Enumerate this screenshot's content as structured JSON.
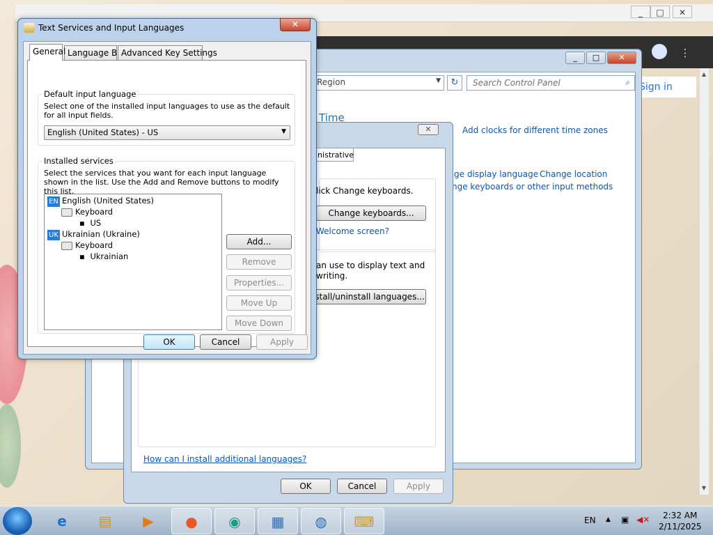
{
  "browser": {
    "title_buttons": [
      "_",
      "□",
      "✕"
    ],
    "sign_in": "Sign in"
  },
  "control_panel": {
    "window_buttons": [
      "_",
      "□",
      "✕"
    ],
    "address": "Region",
    "search_placeholder": "Search Control Panel",
    "heading": "Time",
    "links": {
      "add_clocks": "Add clocks for different time zones",
      "change_display_language": "ge display language",
      "change_location": "Change location",
      "change_keyboards_methods": "nge keyboards or other input methods"
    }
  },
  "region_dialog": {
    "close": "✕",
    "tab_partial": "inistrative",
    "keyboards_text": "lick Change keyboards.",
    "change_keyboards_button": "Change keyboards...",
    "welcome_link": "Welcome screen?",
    "display_text_line1": "an use to display text and",
    "display_text_line2": "writing.",
    "install_button": "stall/uninstall languages...",
    "install_link": "How can I install additional languages?",
    "ok": "OK",
    "cancel": "Cancel",
    "apply": "Apply"
  },
  "text_services": {
    "title": "Text Services and Input Languages",
    "close": "✕",
    "tabs": [
      "General",
      "Language Bar",
      "Advanced Key Settings"
    ],
    "default_group_label": "Default input language",
    "default_desc": "Select one of the installed input languages to use as the default for all input fields.",
    "default_value": "English (United States) - US",
    "installed_group_label": "Installed services",
    "installed_desc": "Select the services that you want for each input language shown in the list. Use the Add and Remove buttons to modify this list.",
    "tree": [
      {
        "badge": "EN",
        "label": "English (United States)"
      },
      {
        "label": "Keyboard"
      },
      {
        "label": "US"
      },
      {
        "badge": "UK",
        "label": "Ukrainian (Ukraine)"
      },
      {
        "label": "Keyboard"
      },
      {
        "label": "Ukrainian"
      }
    ],
    "buttons": {
      "add": "Add...",
      "remove": "Remove",
      "properties": "Properties...",
      "move_up": "Move Up",
      "move_down": "Move Down"
    },
    "ok": "OK",
    "cancel": "Cancel",
    "apply": "Apply"
  },
  "taskbar": {
    "lang": "EN",
    "time": "2:32 AM",
    "date": "2/11/2025"
  }
}
